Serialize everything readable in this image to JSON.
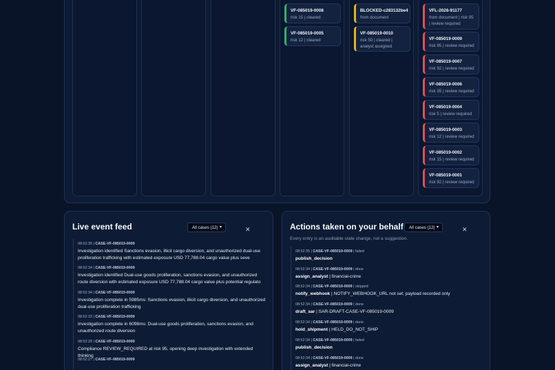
{
  "board": {
    "col4": [
      {
        "id": "VF-085019-0008",
        "meta": "risk 15 | cleared"
      },
      {
        "id": "VF-085019-0005",
        "meta": "risk 12 | cleared"
      }
    ],
    "col5": [
      {
        "id": "BLOCKED-c283132be4",
        "meta": "from document"
      },
      {
        "id": "VF-085019-0010",
        "meta": "risk 50 | cleared | analyst assigned"
      }
    ],
    "col6": [
      {
        "id": "VFL-2026-91177",
        "meta": "from document | risk 95 | review required"
      },
      {
        "id": "VF-085019-0009",
        "meta": "risk 95 | review required"
      },
      {
        "id": "VF-085019-0007",
        "meta": "risk 92 | review required"
      },
      {
        "id": "VF-085019-0006",
        "meta": "risk 35 | review required"
      },
      {
        "id": "VF-085019-0004",
        "meta": "risk 5 | review required"
      },
      {
        "id": "VF-085019-0003",
        "meta": "risk 12 | review required"
      },
      {
        "id": "VF-085019-0002",
        "meta": "risk 15 | review required"
      },
      {
        "id": "VF-085019-0001",
        "meta": "risk 92 | review required"
      }
    ]
  },
  "feed": {
    "title": "Live event feed",
    "filter": "All cases (12)",
    "entries": [
      {
        "time": "08:52:35",
        "case": "CASE-VF-085019-0009",
        "text": "Investigation identified Sanctions evasion, illicit cargo diversion, and unauthorized dual-use proliferation trafficking with estimated exposure USD 77,788.04 cargo value plus seve"
      },
      {
        "time": "08:52:34",
        "case": "CASE-VF-085019-0009",
        "text": "Investigation identified Dual-use goods proliferation, sanctions evasion, and unauthorized route diversion with estimated exposure USD 77,788.04 cargo value plus potential regulato"
      },
      {
        "time": "08:52:34",
        "case": "CASE-VF-085019-0009",
        "text": "Investigation complete in 5985ms: Sanctions evasion, illicit cargo diversion, and unauthorized dual-use proliferation trafficking"
      },
      {
        "time": "08:52:33",
        "case": "CASE-VF-085019-0009",
        "text": "Investigation complete in 6098ms: Dual-use goods proliferation, sanctions evasion, and unauthorized route diversion"
      },
      {
        "time": "08:52:28",
        "case": "CASE-VF-085019-0009",
        "text": "Compliance REVIEW_REQUIRED at risk 95, opening deep investigation with extended thinking"
      },
      {
        "time": "08:52:27",
        "case": "CASE-VF-085019-0009",
        "text": ""
      }
    ]
  },
  "actions": {
    "title": "Actions taken on your behalf",
    "filter": "All cases (12)",
    "subtitle": "Every entry is an auditable state change, not a suggestion.",
    "entries": [
      {
        "time": "08:52:35",
        "case": "CASE-VF-085019-0009",
        "status": "failed",
        "action": "publish_decision",
        "detail": ""
      },
      {
        "time": "08:52:34",
        "case": "CASE-VF-085019-0009",
        "status": "done",
        "action": "assign_analyst",
        "detail": "financial-crime"
      },
      {
        "time": "08:52:34",
        "case": "CASE-VF-085019-0009",
        "status": "skipped",
        "action": "notify_webhook",
        "detail": "NOTIFY_WEBHOOK_URL not set; payload recorded only"
      },
      {
        "time": "08:52:34",
        "case": "CASE-VF-085019-0009",
        "status": "done",
        "action": "draft_sar",
        "detail": "SAR-DRAFT-CASE-VF-085019-0009"
      },
      {
        "time": "08:52:34",
        "case": "CASE-VF-085019-0009",
        "status": "done",
        "action": "hold_shipment",
        "detail": "HELD_DO_NOT_SHIP"
      },
      {
        "time": "08:52:34",
        "case": "CASE-VF-085019-0009",
        "status": "failed",
        "action": "publish_decision",
        "detail": ""
      },
      {
        "time": "08:52:34",
        "case": "CASE-VF-085019-0009",
        "status": "done",
        "action": "assign_analyst",
        "detail": "financial-crime"
      }
    ]
  },
  "colors": {
    "accent_green": "#2fb36b",
    "accent_yellow": "#e0b526",
    "accent_red": "#e05252",
    "background": "#0a1428"
  },
  "icons": {
    "close": "close-icon",
    "dropdown": "chevron-down-icon"
  }
}
